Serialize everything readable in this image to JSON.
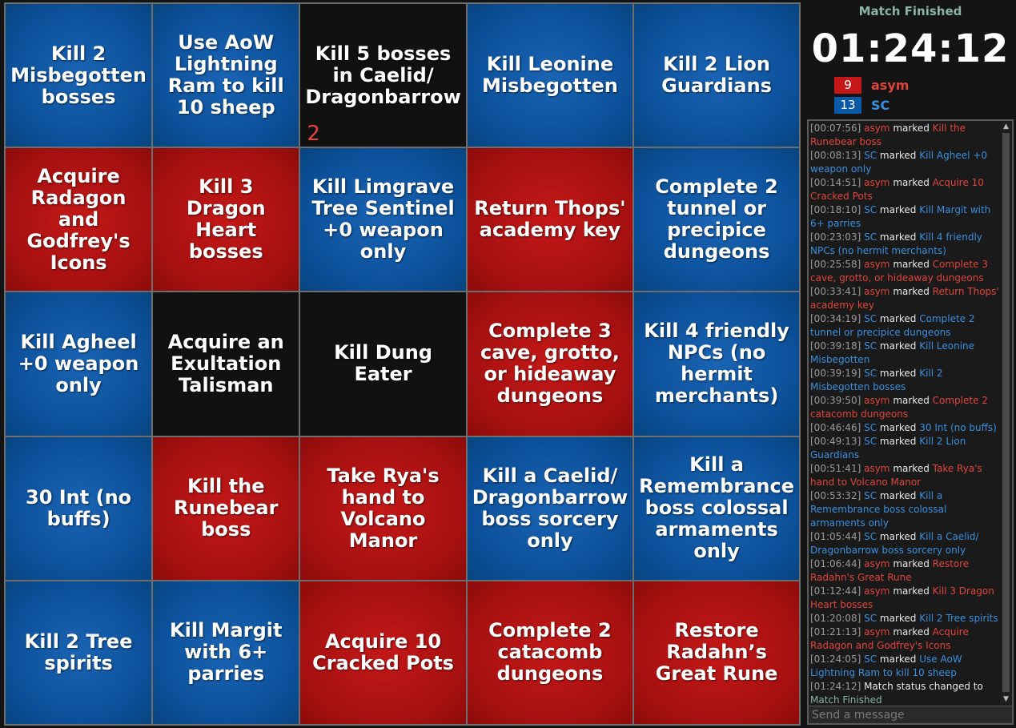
{
  "board": {
    "cells": [
      {
        "text": "Kill 2 Misbegotten bosses",
        "color": "blue"
      },
      {
        "text": "Use AoW Lightning Ram to kill 10 sheep",
        "color": "blue"
      },
      {
        "text": "Kill 5 bosses in Caelid/ Dragonbarrow",
        "color": "black",
        "counter": "2"
      },
      {
        "text": "Kill Leonine Misbegotten",
        "color": "blue"
      },
      {
        "text": "Kill 2 Lion Guardians",
        "color": "blue"
      },
      {
        "text": "Acquire Radagon and Godfrey's Icons",
        "color": "red"
      },
      {
        "text": "Kill 3 Dragon Heart bosses",
        "color": "red"
      },
      {
        "text": "Kill Limgrave Tree Sentinel +0 weapon only",
        "color": "blue"
      },
      {
        "text": "Return Thops' academy key",
        "color": "red"
      },
      {
        "text": "Complete 2 tunnel or precipice dungeons",
        "color": "blue"
      },
      {
        "text": "Kill Agheel +0 weapon only",
        "color": "blue"
      },
      {
        "text": "Acquire an Exultation Talisman",
        "color": "black"
      },
      {
        "text": "Kill Dung Eater",
        "color": "black"
      },
      {
        "text": "Complete 3 cave, grotto, or hideaway dungeons",
        "color": "red"
      },
      {
        "text": "Kill 4 friendly NPCs (no hermit merchants)",
        "color": "blue"
      },
      {
        "text": "30 Int (no buffs)",
        "color": "blue"
      },
      {
        "text": "Kill the Runebear boss",
        "color": "red"
      },
      {
        "text": "Take Rya's hand to Volcano Manor",
        "color": "red"
      },
      {
        "text": "Kill a Caelid/ Dragonbarrow boss sorcery only",
        "color": "blue"
      },
      {
        "text": "Kill a Remembrance boss colossal armaments only",
        "color": "blue"
      },
      {
        "text": "Kill 2 Tree spirits",
        "color": "blue"
      },
      {
        "text": "Kill Margit with 6+ parries",
        "color": "blue"
      },
      {
        "text": "Acquire 10 Cracked Pots",
        "color": "red"
      },
      {
        "text": "Complete 2 catacomb dungeons",
        "color": "red"
      },
      {
        "text": "Restore Radahn’s Great Rune",
        "color": "red"
      }
    ]
  },
  "match": {
    "status": "Match Finished",
    "timer": "01:24:12"
  },
  "scores": [
    {
      "id": "asym",
      "score": "9",
      "name": "asym",
      "color": "#c41818"
    },
    {
      "id": "sc",
      "score": "13",
      "name": "SC",
      "color": "#0b5aa8"
    }
  ],
  "log": [
    {
      "ts": "[00:07:56]",
      "player": "asym",
      "team": "red",
      "action": " marked ",
      "goal": "Kill the Runebear boss"
    },
    {
      "ts": "[00:08:13]",
      "player": "SC",
      "team": "blue",
      "action": " marked ",
      "goal": "Kill Agheel +0 weapon only"
    },
    {
      "ts": "[00:14:51]",
      "player": "asym",
      "team": "red",
      "action": " marked ",
      "goal": "Acquire 10 Cracked Pots"
    },
    {
      "ts": "[00:18:10]",
      "player": "SC",
      "team": "blue",
      "action": " marked ",
      "goal": "Kill Margit with 6+ parries"
    },
    {
      "ts": "[00:23:03]",
      "player": "SC",
      "team": "blue",
      "action": " marked ",
      "goal": "Kill 4 friendly NPCs (no hermit merchants)"
    },
    {
      "ts": "[00:25:58]",
      "player": "asym",
      "team": "red",
      "action": " marked ",
      "goal": "Complete 3 cave, grotto, or hideaway dungeons"
    },
    {
      "ts": "[00:33:41]",
      "player": "asym",
      "team": "red",
      "action": " marked ",
      "goal": "Return Thops' academy key"
    },
    {
      "ts": "[00:34:19]",
      "player": "SC",
      "team": "blue",
      "action": " marked ",
      "goal": "Complete 2 tunnel or precipice dungeons"
    },
    {
      "ts": "[00:39:18]",
      "player": "SC",
      "team": "blue",
      "action": " marked ",
      "goal": "Kill Leonine Misbegotten"
    },
    {
      "ts": "[00:39:19]",
      "player": "SC",
      "team": "blue",
      "action": " marked ",
      "goal": "Kill 2 Misbegotten bosses"
    },
    {
      "ts": "[00:39:50]",
      "player": "asym",
      "team": "red",
      "action": " marked ",
      "goal": "Complete 2 catacomb dungeons"
    },
    {
      "ts": "[00:46:46]",
      "player": "SC",
      "team": "blue",
      "action": " marked ",
      "goal": "30 Int (no buffs)"
    },
    {
      "ts": "[00:49:13]",
      "player": "SC",
      "team": "blue",
      "action": " marked ",
      "goal": "Kill 2 Lion Guardians"
    },
    {
      "ts": "[00:51:41]",
      "player": "asym",
      "team": "red",
      "action": " marked ",
      "goal": "Take Rya's hand to Volcano Manor"
    },
    {
      "ts": "[00:53:32]",
      "player": "SC",
      "team": "blue",
      "action": " marked ",
      "goal": "Kill a Remembrance boss colossal armaments only"
    },
    {
      "ts": "[01:05:44]",
      "player": "SC",
      "team": "blue",
      "action": " marked ",
      "goal": "Kill a Caelid/ Dragonbarrow boss sorcery only"
    },
    {
      "ts": "[01:06:44]",
      "player": "asym",
      "team": "red",
      "action": " marked ",
      "goal": "Restore Radahn's Great Rune"
    },
    {
      "ts": "[01:12:44]",
      "player": "asym",
      "team": "red",
      "action": " marked ",
      "goal": "Kill 3 Dragon Heart bosses"
    },
    {
      "ts": "[01:20:08]",
      "player": "SC",
      "team": "blue",
      "action": " marked ",
      "goal": "Kill 2 Tree spirits"
    },
    {
      "ts": "[01:21:13]",
      "player": "asym",
      "team": "red",
      "action": " marked ",
      "goal": "Acquire Radagon and Godfrey's Icons"
    },
    {
      "ts": "[01:24:05]",
      "player": "SC",
      "team": "blue",
      "action": " marked ",
      "goal": "Use AoW Lightning Ram to kill 10 sheep"
    },
    {
      "ts": "[01:24:12]",
      "player": "",
      "team": "status",
      "action": " Match status changed to ",
      "goal": "Match Finished"
    }
  ],
  "chat": {
    "placeholder": "Send a message"
  },
  "icons": {
    "scroll_up": "▲",
    "scroll_down": "▼"
  }
}
